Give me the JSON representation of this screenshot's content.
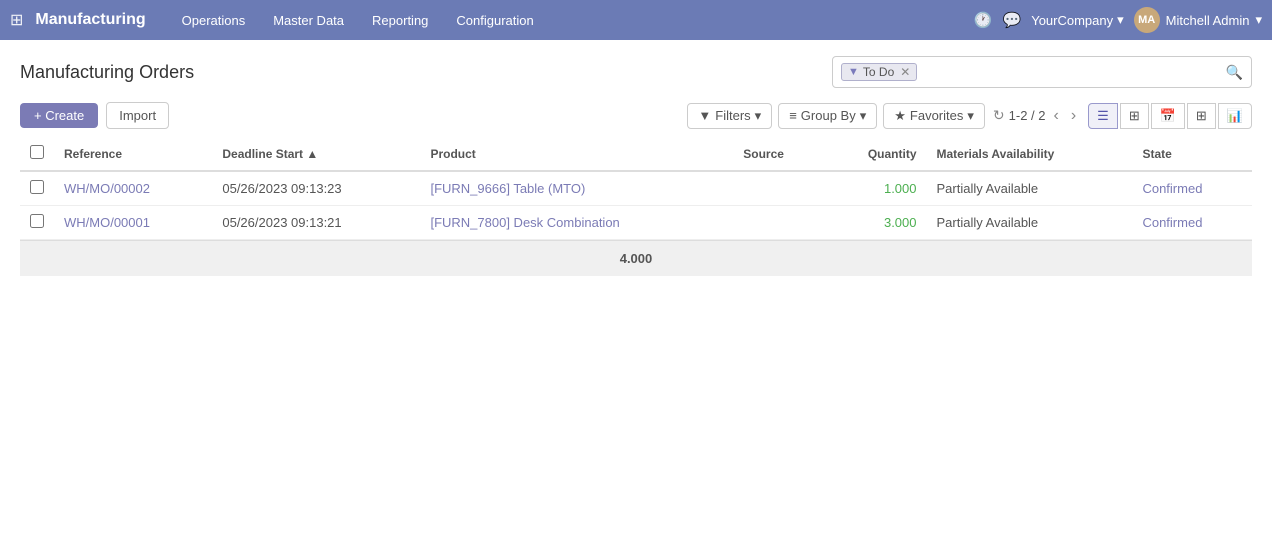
{
  "app": {
    "title": "Manufacturing",
    "nav_links": [
      "Operations",
      "Master Data",
      "Reporting",
      "Configuration"
    ]
  },
  "topbar": {
    "company": "YourCompany",
    "user": "Mitchell Admin"
  },
  "page": {
    "title": "Manufacturing Orders"
  },
  "toolbar": {
    "create_label": "+ Create",
    "import_label": "Import",
    "filters_label": "Filters",
    "group_by_label": "Group By",
    "favorites_label": "Favorites",
    "pager_text": "1-2 / 2"
  },
  "search": {
    "filter_tag": "To Do",
    "placeholder": ""
  },
  "table": {
    "columns": [
      "Reference",
      "Deadline Start",
      "Product",
      "Source",
      "Quantity",
      "Materials Availability",
      "State"
    ],
    "rows": [
      {
        "reference": "WH/MO/00002",
        "deadline_start": "05/26/2023 09:13:23",
        "product": "[FURN_9666] Table (MTO)",
        "source": "",
        "quantity": "1.000",
        "materials_availability": "Partially Available",
        "state": "Confirmed"
      },
      {
        "reference": "WH/MO/00001",
        "deadline_start": "05/26/2023 09:13:21",
        "product": "[FURN_7800] Desk Combination",
        "source": "",
        "quantity": "3.000",
        "materials_availability": "Partially Available",
        "state": "Confirmed"
      }
    ],
    "total": "4.000"
  }
}
